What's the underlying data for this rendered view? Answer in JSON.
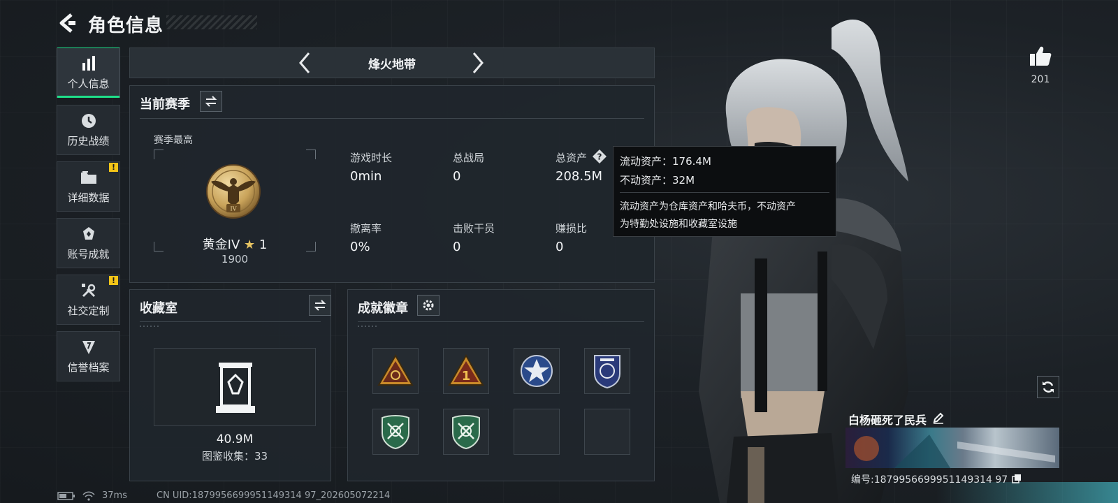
{
  "header": {
    "title": "角色信息"
  },
  "nav": {
    "items": [
      {
        "label": "个人信息",
        "active": true,
        "icon": "bar-chart-icon"
      },
      {
        "label": "历史战绩",
        "icon": "clock-icon"
      },
      {
        "label": "详细数据",
        "icon": "folder-icon",
        "badge": "!"
      },
      {
        "label": "账号成就",
        "icon": "achievement-icon"
      },
      {
        "label": "社交定制",
        "icon": "tools-icon",
        "badge": "!"
      },
      {
        "label": "信誉档案",
        "icon": "shield-icon"
      }
    ]
  },
  "mode": {
    "title": "烽火地带"
  },
  "season": {
    "title": "当前赛季",
    "best_label": "赛季最高",
    "rank_name": "黄金IV",
    "rank_stars": "1",
    "rank_points": "1900",
    "rank_numeral": "IV",
    "stats": [
      {
        "label": "游戏时长",
        "value": "0min"
      },
      {
        "label": "总战局",
        "value": "0"
      },
      {
        "label": "总资产",
        "value": "208.5M"
      },
      {
        "label": "撤离率",
        "value": "0%"
      },
      {
        "label": "击败干员",
        "value": "0"
      },
      {
        "label": "赚损比",
        "value": "0"
      }
    ]
  },
  "tooltip": {
    "liquid": "流动资产：176.4M",
    "fixed": "不动资产：32M",
    "desc_line1": "流动资产为仓库资产和哈夫币，不动资产",
    "desc_line2": "为特勤处设施和收藏室设施"
  },
  "collection": {
    "title": "收藏室",
    "value": "40.9M",
    "catalog": "图鉴收集：33"
  },
  "achievements": {
    "title": "成就徽章",
    "badge_icons": [
      "warning-triangle-badge",
      "rank-one-badge",
      "star-emblem-badge",
      "police-shield-badge",
      "green-shield-badge",
      "green-shield-badge",
      "",
      ""
    ]
  },
  "profile": {
    "likes": "201",
    "player_name": "白杨砸死了民兵",
    "uid_label": "编号:1879956699951149314 97"
  },
  "status_bar": {
    "ping": "37ms",
    "uid": "CN UID:1879956699951149314 97_202605072214"
  },
  "colors": {
    "accent": "#1fe08a",
    "badge": "#f5c518",
    "gold": "#c9a35a"
  }
}
